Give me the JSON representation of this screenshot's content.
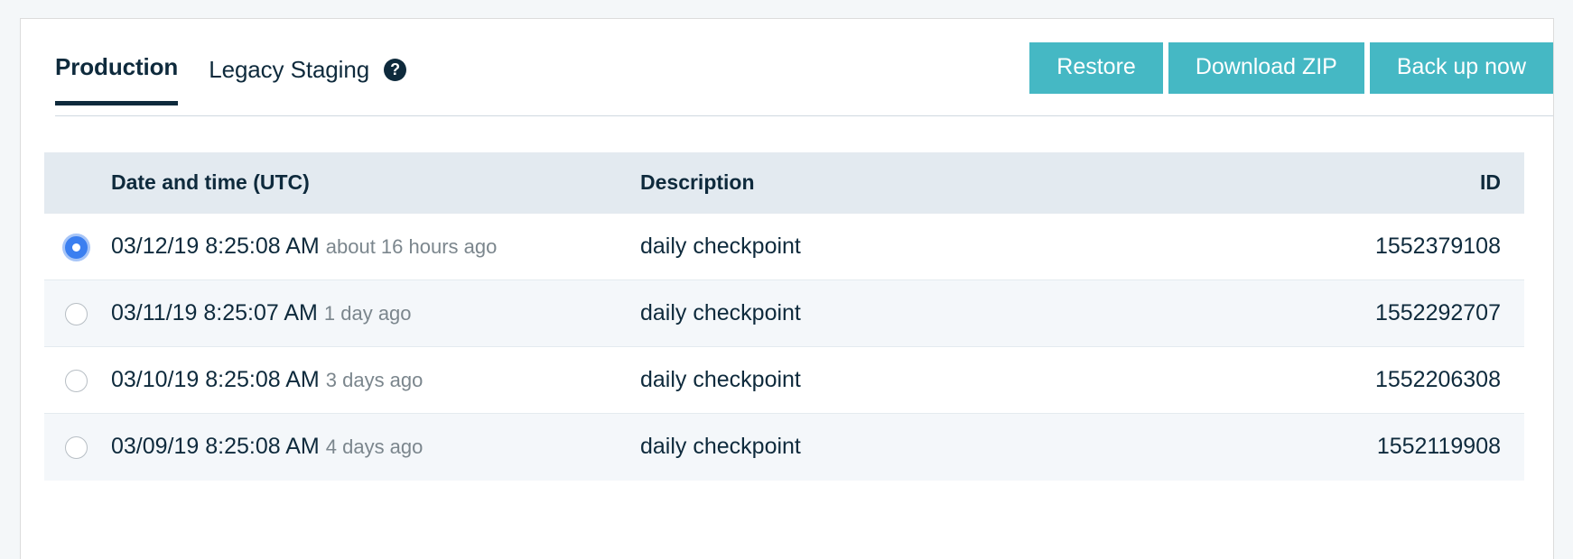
{
  "colors": {
    "accent_button": "#45b8c4",
    "tab_active_text": "#0e2a3c",
    "table_header_bg": "#e3eaf0",
    "row_alt_bg": "#f4f7fa",
    "radio_selected": "#3b7ff0",
    "page_bg": "#f4f7f9"
  },
  "tabs": [
    {
      "label": "Production",
      "active": true
    },
    {
      "label": "Legacy Staging",
      "active": false
    }
  ],
  "help_icon_glyph": "?",
  "actions": [
    {
      "label": "Restore"
    },
    {
      "label": "Download ZIP"
    },
    {
      "label": "Back up now"
    }
  ],
  "table": {
    "columns": [
      "",
      "Date and time (UTC)",
      "Description",
      "ID"
    ],
    "rows": [
      {
        "selected": true,
        "datetime": "03/12/19 8:25:08 AM",
        "relative": "about 16 hours ago",
        "description": "daily checkpoint",
        "id": "1552379108"
      },
      {
        "selected": false,
        "datetime": "03/11/19 8:25:07 AM",
        "relative": "1 day ago",
        "description": "daily checkpoint",
        "id": "1552292707"
      },
      {
        "selected": false,
        "datetime": "03/10/19 8:25:08 AM",
        "relative": "3 days ago",
        "description": "daily checkpoint",
        "id": "1552206308"
      },
      {
        "selected": false,
        "datetime": "03/09/19 8:25:08 AM",
        "relative": "4 days ago",
        "description": "daily checkpoint",
        "id": "1552119908"
      }
    ]
  }
}
